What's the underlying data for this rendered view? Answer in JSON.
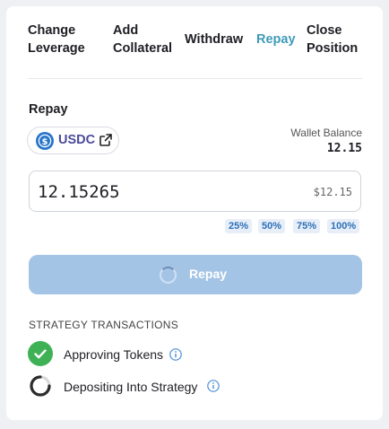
{
  "tabs": [
    {
      "line1": "Change",
      "line2": "Leverage"
    },
    {
      "line1": "Add",
      "line2": "Collateral"
    },
    {
      "label": "Withdraw"
    },
    {
      "label": "Repay"
    },
    {
      "line1": "Close",
      "line2": "Position"
    }
  ],
  "active_tab": "Repay",
  "accent_color": "#3f9bb8",
  "repay": {
    "section_label": "Repay",
    "token": {
      "symbol": "USDC",
      "icon": "usdc-coin-icon"
    },
    "wallet_label": "Wallet Balance",
    "wallet_value": "12.15",
    "amount": "12.15265",
    "amount_usd": "$12.15",
    "percent_options": [
      "25%",
      "50%",
      "75%",
      "100%"
    ],
    "button_label": "Repay",
    "button_color": "#a4c4e6",
    "button_state": "loading"
  },
  "strategy": {
    "heading": "STRATEGY TRANSACTIONS",
    "steps": [
      {
        "label": "Approving Tokens",
        "status": "complete",
        "icon": "check-icon"
      },
      {
        "label": "Depositing Into Strategy",
        "status": "in-progress",
        "icon": "spinner-icon"
      }
    ],
    "success_color": "#3fb155"
  }
}
